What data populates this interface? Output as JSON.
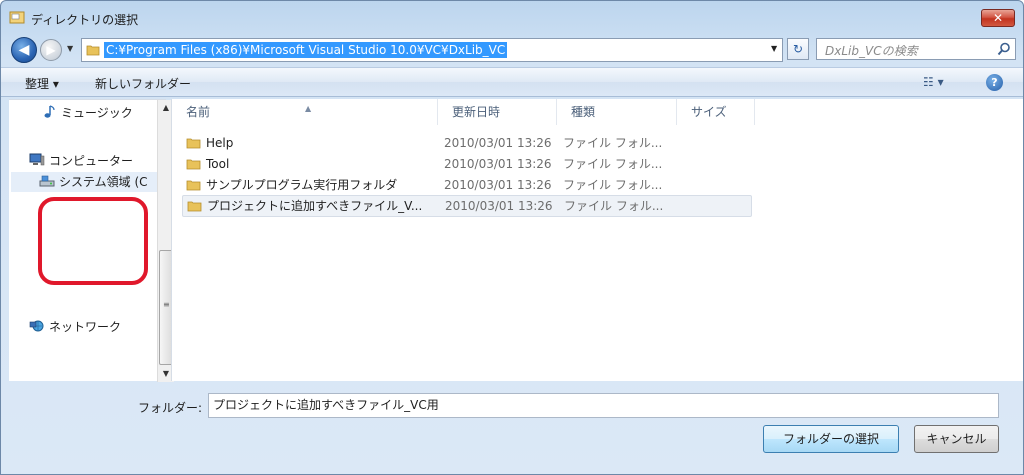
{
  "window": {
    "title": "ディレクトリの選択",
    "close_label": "✕"
  },
  "address_bar": {
    "path": "C:¥Program Files (x86)¥Microsoft Visual Studio 10.0¥VC¥DxLib_VC",
    "back_glyph": "◀",
    "forward_glyph": "▶",
    "refresh_glyph": "↻",
    "dropdown_glyph": "▼"
  },
  "search": {
    "placeholder": "DxLib_VCの検索"
  },
  "command_bar": {
    "organize_label": "整理 ▾",
    "new_folder_label": "新しいフォルダー",
    "views_label": "☷ ▾",
    "help_label": "?"
  },
  "nav_pane": {
    "music": "ミュージック",
    "computer": "コンピューター",
    "system_drive": "システム領域 (C",
    "network": "ネットワーク"
  },
  "file_list": {
    "columns": [
      "名前",
      "更新日時",
      "種類",
      "サイズ"
    ],
    "rows": [
      {
        "name": "Help",
        "date": "2010/03/01 13:26",
        "type": "ファイル フォル..."
      },
      {
        "name": "Tool",
        "date": "2010/03/01 13:26",
        "type": "ファイル フォル..."
      },
      {
        "name": "サンプルプログラム実行用フォルダ",
        "date": "2010/03/01 13:26",
        "type": "ファイル フォル..."
      },
      {
        "name": "プロジェクトに追加すべきファイル_V...",
        "date": "2010/03/01 13:26",
        "type": "ファイル フォル..."
      }
    ]
  },
  "bottom": {
    "folder_label": "フォルダー:",
    "folder_value": "プロジェクトに追加すべきファイル_VC用",
    "select_button": "フォルダーの選択",
    "cancel_button": "キャンセル"
  }
}
